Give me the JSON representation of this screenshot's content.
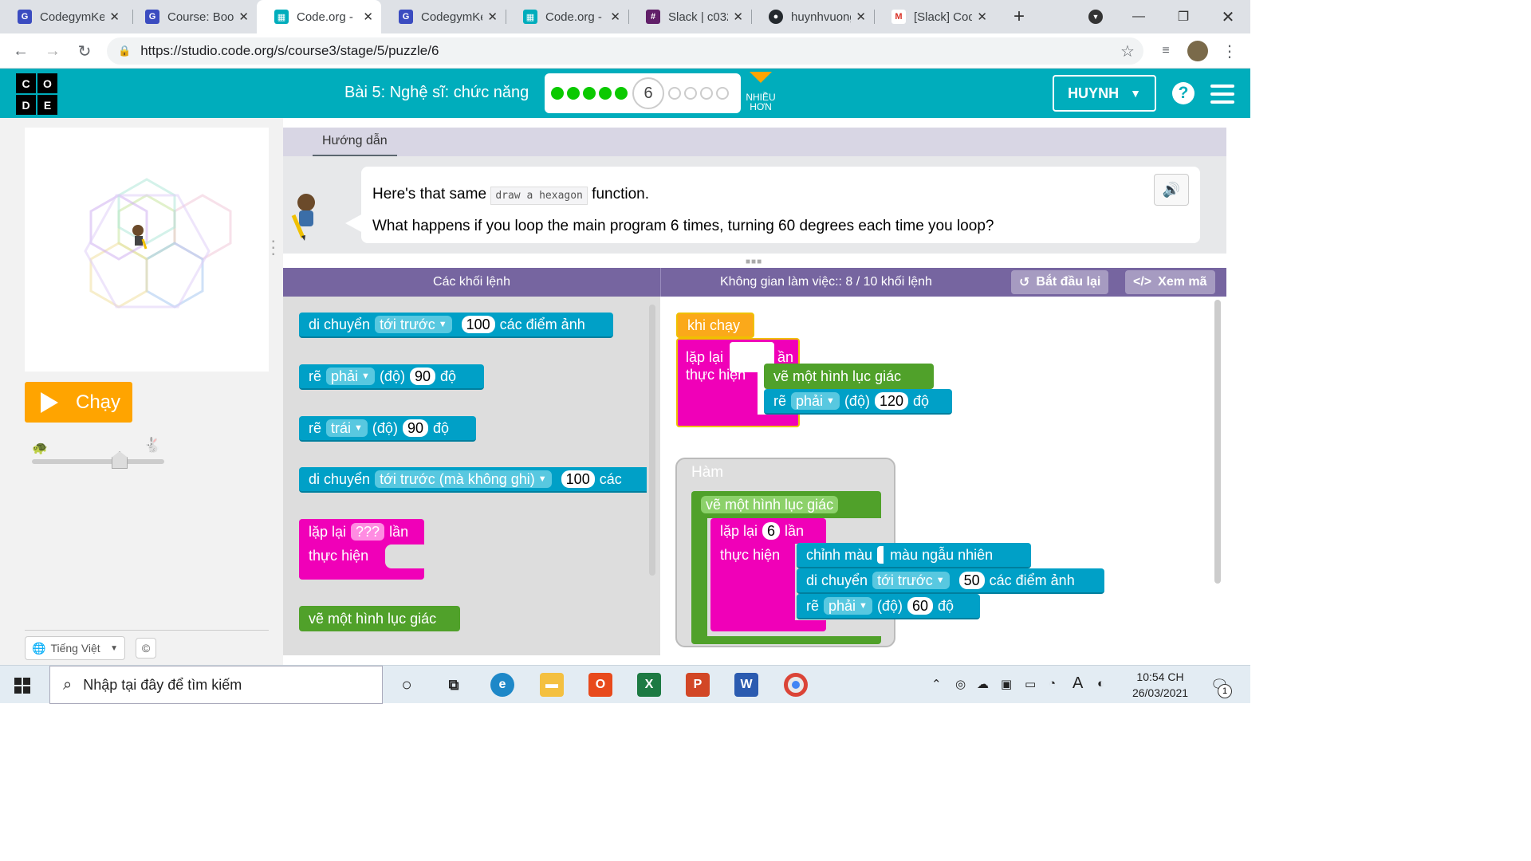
{
  "browser": {
    "tabs": [
      {
        "title": "CodegymKe",
        "color": "#3b4cc0",
        "glyph": "G"
      },
      {
        "title": "Course: Boo",
        "color": "#3b4cc0",
        "glyph": "G"
      },
      {
        "title": "Code.org - ",
        "color": "#00adbc",
        "glyph": "▦",
        "active": true
      },
      {
        "title": "CodegymKe",
        "color": "#3b4cc0",
        "glyph": "G"
      },
      {
        "title": "Code.org - ",
        "color": "#00adbc",
        "glyph": "▦"
      },
      {
        "title": "Slack | c032",
        "color": "#611f69",
        "glyph": "#"
      },
      {
        "title": "huynhvuong",
        "color": "#24292e",
        "glyph": "●"
      },
      {
        "title": "[Slack] Cod",
        "color": "#d93025",
        "glyph": "M"
      }
    ],
    "url": "https://studio.code.org/s/course3/stage/5/puzzle/6"
  },
  "header": {
    "logo_letters": [
      "C",
      "O",
      "D",
      "E"
    ],
    "lesson_title": "Bài 5: Nghệ sĩ: chức năng",
    "current_level": "6",
    "levels_done": 5,
    "levels_todo": 4,
    "more_label_1": "NHIỀU",
    "more_label_2": "HƠN",
    "user_name": "HUYNH",
    "help": "?"
  },
  "left": {
    "run_label": "Chạy",
    "speed_fraction": 0.68,
    "language": "Tiếng Việt",
    "copyright": "©"
  },
  "instructions": {
    "tab_label": "Hướng dẫn",
    "line1_before": "Here's that same",
    "line1_code": "draw a hexagon",
    "line1_after": "function.",
    "line2": "What happens if you loop the main program 6 times, turning 60 degrees each time you loop?"
  },
  "workspace": {
    "toolbox_title": "Các khối lệnh",
    "workspace_title": "Không gian làm việc:: 8 / 10 khối lệnh",
    "reset_label": "Bắt đầu lại",
    "showcode_label": "Xem mã"
  },
  "toolbox_blocks": {
    "move_label": "di chuyển",
    "move_dir": "tới trước",
    "move_value": "100",
    "move_unit": "các điểm ảnh",
    "turn_label": "rẽ",
    "turn_right": "phải",
    "turn_left": "trái",
    "turn_deg_label": "(độ)",
    "turn_value": "90",
    "turn_unit": "độ",
    "jump_label": "di chuyển",
    "jump_dir": "tới trước (mà không ghi)",
    "jump_value": "100",
    "jump_unit": "các",
    "repeat_label": "lặp lại",
    "repeat_value": "???",
    "repeat_unit": "lần",
    "do_label": "thực hiện",
    "hexagon_label": "vẽ một hình lục giác"
  },
  "main_program": {
    "when_run": "khi chạy",
    "repeat_label": "lặp lại",
    "repeat_unit_partial": "ần",
    "do_label": "thực hiện",
    "hexagon_call": "vẽ một hình lục giác",
    "turn_label": "rẽ",
    "turn_dir": "phải",
    "turn_deg_label": "(độ)",
    "turn_value": "120",
    "turn_unit": "độ"
  },
  "function_def": {
    "header": "Hàm",
    "name": "vẽ một hình lục giác",
    "repeat_label": "lặp lại",
    "repeat_value": "6",
    "repeat_unit": "lần",
    "do_label": "thực hiện",
    "color_label": "chỉnh màu",
    "color_value": "màu ngẫu nhiên",
    "move_label": "di chuyển",
    "move_dir": "tới trước",
    "move_value": "50",
    "move_unit": "các điểm ảnh",
    "turn_label": "rẽ",
    "turn_dir": "phải",
    "turn_deg_label": "(độ)",
    "turn_value": "60",
    "turn_unit": "độ"
  },
  "taskbar": {
    "search_placeholder": "Nhập tại đây để tìm kiếm",
    "time": "10:54 CH",
    "date": "26/03/2021",
    "notification_count": "1"
  }
}
